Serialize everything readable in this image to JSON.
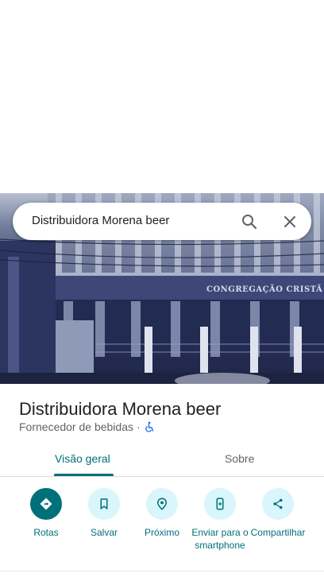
{
  "search": {
    "query": "Distribuidora Morena beer"
  },
  "hero": {
    "building_sign": "CONGREGAÇÃO CRISTÃ NO BRA"
  },
  "place": {
    "title": "Distribuidora Morena beer",
    "category": "Fornecedor de bebidas",
    "separator": "·",
    "accessibility_icon": "wheelchair-icon"
  },
  "tabs": [
    {
      "label": "Visão geral",
      "active": true
    },
    {
      "label": "Sobre",
      "active": false
    }
  ],
  "actions": [
    {
      "label": "Rotas",
      "icon": "directions-icon"
    },
    {
      "label": "Salvar",
      "icon": "bookmark-icon"
    },
    {
      "label": "Próximo",
      "icon": "nearby-icon"
    },
    {
      "label": "Enviar para o smartphone",
      "icon": "send-to-phone-icon"
    },
    {
      "label": "Compartilhar",
      "icon": "share-icon"
    }
  ],
  "colors": {
    "accent": "#00707b",
    "action_bg": "#d8f6fb",
    "accessibility_blue": "#1a73e8"
  }
}
